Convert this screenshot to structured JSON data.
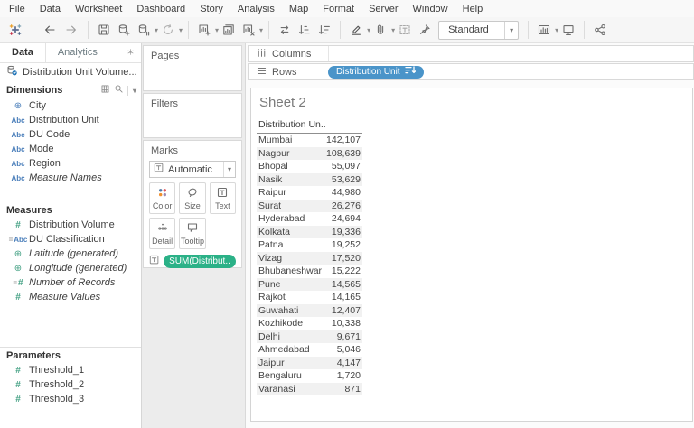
{
  "menu": {
    "items": [
      "File",
      "Data",
      "Worksheet",
      "Dashboard",
      "Story",
      "Analysis",
      "Map",
      "Format",
      "Server",
      "Window",
      "Help"
    ]
  },
  "toolbar": {
    "fit_value": "Standard",
    "groups": [
      [
        {
          "name": "tableau-logo-icon",
          "icon": "logo"
        }
      ],
      [
        {
          "name": "undo-button",
          "icon": "arrow-left"
        },
        {
          "name": "redo-button",
          "icon": "arrow-right"
        }
      ],
      [
        {
          "name": "save-button",
          "icon": "save"
        },
        {
          "name": "new-datasource-button",
          "icon": "datasource-add"
        },
        {
          "name": "pause-updates-button",
          "icon": "datasource-pause",
          "caret": true
        },
        {
          "name": "run-update-button",
          "icon": "refresh",
          "caret": true
        }
      ],
      [
        {
          "name": "new-worksheet-button",
          "icon": "worksheet-add",
          "caret": true
        },
        {
          "name": "duplicate-sheet-button",
          "icon": "duplicate"
        },
        {
          "name": "clear-sheet-button",
          "icon": "worksheet-clear",
          "caret": true
        }
      ],
      [
        {
          "name": "swap-rows-columns-button",
          "icon": "swap"
        },
        {
          "name": "sort-ascending-button",
          "icon": "sort-asc"
        },
        {
          "name": "sort-descending-button",
          "icon": "sort-desc"
        }
      ],
      [
        {
          "name": "highlight-button",
          "icon": "highlight",
          "caret": true
        },
        {
          "name": "format-links-button",
          "icon": "paperclip",
          "caret": true
        },
        {
          "name": "show-mark-labels-button",
          "icon": "mark-labels"
        },
        {
          "name": "fix-axes-button",
          "icon": "pin"
        },
        {
          "name": "fit-selector",
          "type": "dropdown"
        }
      ],
      [
        {
          "name": "show-me-button",
          "icon": "show-me",
          "caret": true
        },
        {
          "name": "presentation-mode-button",
          "icon": "presentation"
        }
      ],
      [
        {
          "name": "share-button",
          "icon": "share"
        }
      ]
    ]
  },
  "data_pane": {
    "tabs": [
      {
        "label": "Data",
        "active": true
      },
      {
        "label": "Analytics",
        "active": false
      }
    ],
    "datasource": {
      "label": "Distribution Unit Volume..."
    },
    "dimensions": {
      "title": "Dimensions",
      "items": [
        {
          "label": "City",
          "icon": "globe-blue-icon"
        },
        {
          "label": "Distribution Unit",
          "icon": "abc-icon"
        },
        {
          "label": "DU Code",
          "icon": "abc-icon"
        },
        {
          "label": "Mode",
          "icon": "abc-icon"
        },
        {
          "label": "Region",
          "icon": "abc-icon"
        },
        {
          "label": "Measure Names",
          "icon": "abc-icon",
          "italic": true
        }
      ]
    },
    "measures": {
      "title": "Measures",
      "items": [
        {
          "label": "Distribution Volume",
          "icon": "hash-green-icon"
        },
        {
          "label": "DU Classification",
          "icon": "calc-abc-icon"
        },
        {
          "label": "Latitude (generated)",
          "icon": "globe-green-icon",
          "italic": true
        },
        {
          "label": "Longitude (generated)",
          "icon": "globe-green-icon",
          "italic": true
        },
        {
          "label": "Number of Records",
          "icon": "calc-hash-icon",
          "italic": true
        },
        {
          "label": "Measure Values",
          "icon": "hash-green-icon",
          "italic": true
        }
      ]
    },
    "parameters": {
      "title": "Parameters",
      "items": [
        {
          "label": "Threshold_1",
          "icon": "hash-green-icon"
        },
        {
          "label": "Threshold_2",
          "icon": "hash-green-icon"
        },
        {
          "label": "Threshold_3",
          "icon": "hash-green-icon"
        }
      ]
    }
  },
  "cards": {
    "pages": {
      "title": "Pages"
    },
    "filters": {
      "title": "Filters"
    },
    "marks": {
      "title": "Marks",
      "mark_type": "Automatic",
      "buttons": [
        {
          "label": "Color",
          "icon": "color-icon"
        },
        {
          "label": "Size",
          "icon": "size-icon"
        },
        {
          "label": "Text",
          "icon": "text-icon"
        },
        {
          "label": "Detail",
          "icon": "detail-icon"
        },
        {
          "label": "Tooltip",
          "icon": "tooltip-icon"
        }
      ],
      "pill": {
        "label": "SUM(Distribut..",
        "color": "#2bb187"
      }
    }
  },
  "shelves": {
    "columns": {
      "label": "Columns",
      "pills": []
    },
    "rows": {
      "label": "Rows",
      "pills": [
        {
          "label": "Distribution Unit",
          "sorted": "descending",
          "color": "#4a94c9"
        }
      ]
    }
  },
  "sheet": {
    "title": "Sheet 2",
    "column_header": "Distribution Un..",
    "rows": [
      {
        "name": "Mumbai",
        "value": "142,107"
      },
      {
        "name": "Nagpur",
        "value": "108,639"
      },
      {
        "name": "Bhopal",
        "value": "55,097"
      },
      {
        "name": "Nasik",
        "value": "53,629"
      },
      {
        "name": "Raipur",
        "value": "44,980"
      },
      {
        "name": "Surat",
        "value": "26,276"
      },
      {
        "name": "Hyderabad",
        "value": "24,694"
      },
      {
        "name": "Kolkata",
        "value": "19,336"
      },
      {
        "name": "Patna",
        "value": "19,252"
      },
      {
        "name": "Vizag",
        "value": "17,520"
      },
      {
        "name": "Bhubaneshwar",
        "value": "15,222"
      },
      {
        "name": "Pune",
        "value": "14,565"
      },
      {
        "name": "Rajkot",
        "value": "14,165"
      },
      {
        "name": "Guwahati",
        "value": "12,407"
      },
      {
        "name": "Kozhikode",
        "value": "10,338"
      },
      {
        "name": "Delhi",
        "value": "9,671"
      },
      {
        "name": "Ahmedabad",
        "value": "5,046"
      },
      {
        "name": "Jaipur",
        "value": "4,147"
      },
      {
        "name": "Bengaluru",
        "value": "1,720"
      },
      {
        "name": "Varanasi",
        "value": "871"
      }
    ]
  },
  "colors": {
    "dimension_pill": "#4a94c9",
    "measure_pill": "#2bb187",
    "dimension_icon": "#4a7eba",
    "measure_icon": "#44a184",
    "row_band": "#f1f1f1"
  }
}
